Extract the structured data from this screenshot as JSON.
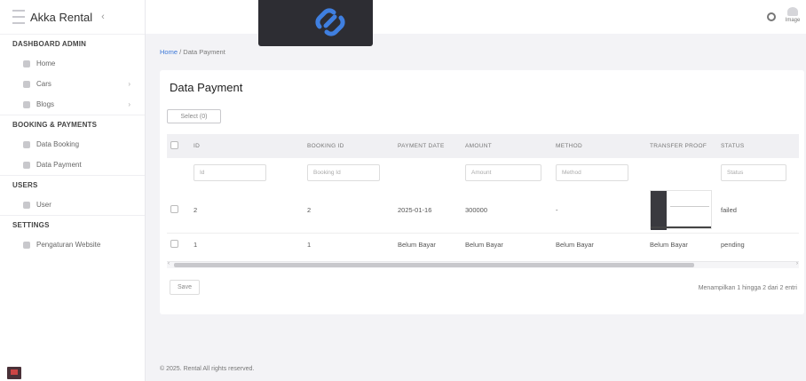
{
  "app": {
    "title": "Akka Rental",
    "collapse_icon": "chevron-left-icon"
  },
  "sidebar": {
    "sections": [
      {
        "label": "DASHBOARD ADMIN",
        "items": [
          {
            "label": "Home",
            "icon": "home-icon",
            "chevron": ""
          },
          {
            "label": "Cars",
            "icon": "car-icon",
            "chevron": "›"
          },
          {
            "label": "Blogs",
            "icon": "blog-icon",
            "chevron": "›"
          }
        ]
      },
      {
        "label": "BOOKING & PAYMENTS",
        "items": [
          {
            "label": "Data Booking",
            "icon": "booking-icon"
          },
          {
            "label": "Data Payment",
            "icon": "payment-icon"
          }
        ]
      },
      {
        "label": "USERS",
        "items": [
          {
            "label": "User",
            "icon": "user-icon"
          }
        ]
      },
      {
        "label": "SETTINGS",
        "items": [
          {
            "label": "Pengaturan Website",
            "icon": "settings-icon"
          }
        ]
      }
    ]
  },
  "topbar": {
    "profile_label": "Image"
  },
  "breadcrumb": {
    "home": "Home",
    "separator": " / ",
    "current": "Data Payment"
  },
  "card": {
    "title": "Data Payment",
    "select_button": "Select (0)",
    "columns": [
      "ID",
      "BOOKING ID",
      "PAYMENT DATE",
      "AMOUNT",
      "METHOD",
      "TRANSFER PROOF",
      "STATUS"
    ],
    "filters": [
      "Id",
      "Booking Id",
      "",
      "Amount",
      "Method",
      "",
      "Status"
    ],
    "rows": [
      {
        "id": "2",
        "booking_id": "2",
        "payment_date": "2025-01-16",
        "amount": "300000",
        "method": "-",
        "proof": "image",
        "status": "failed"
      },
      {
        "id": "1",
        "booking_id": "1",
        "payment_date": "Belum Bayar",
        "amount": "Belum Bayar",
        "method": "Belum Bayar",
        "proof": "Belum Bayar",
        "status": "pending"
      }
    ],
    "save_button": "Save",
    "paging_text": "Menampilkan 1 hingga 2 dari 2 entri"
  },
  "footer": {
    "text": "© 2025. Rental All rights reserved."
  },
  "colors": {
    "link": "#3c78d8",
    "sidebar_bg": "#ffffff",
    "page_bg": "#f3f3f6"
  }
}
